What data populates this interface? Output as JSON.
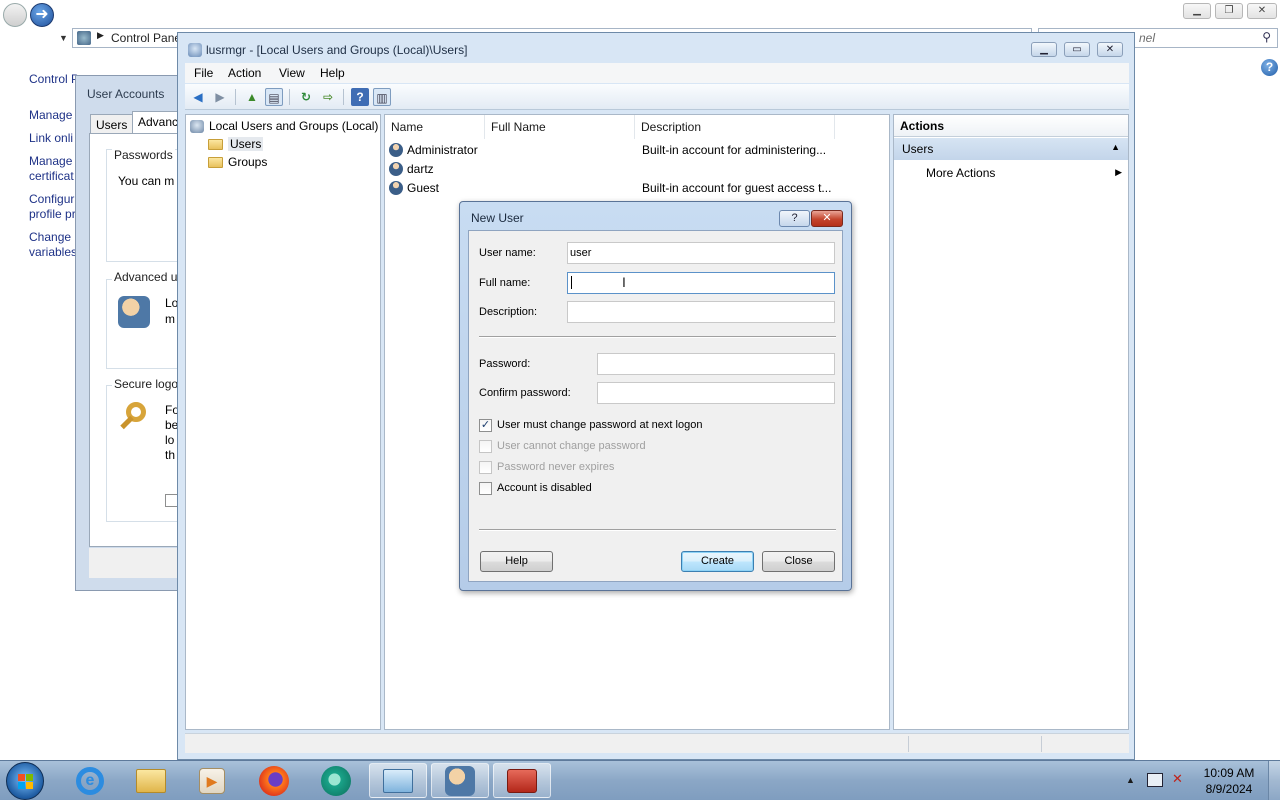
{
  "control_panel": {
    "address": "Control Panel",
    "search_placeholder": "nel",
    "heading": "Control P",
    "tasks": [
      "Manage",
      "Link onli",
      "Manage certificat",
      "Configur profile pr",
      "Change variables"
    ]
  },
  "user_accounts_dialog": {
    "title": "User Accounts",
    "tabs": [
      "Users",
      "Advanc"
    ],
    "passwords_group": "Passwords",
    "passwords_text": "You can m",
    "advanced_group": "Advanced u",
    "advanced_text_1": "Lo",
    "advanced_text_2": "m",
    "secure_group": "Secure logo",
    "secure_text": [
      "Fo",
      "be",
      "lo",
      "th"
    ]
  },
  "mmc": {
    "title": "lusrmgr - [Local Users and Groups (Local)\\Users]",
    "menu": [
      "File",
      "Action",
      "View",
      "Help"
    ],
    "tree": {
      "root": "Local Users and Groups (Local)",
      "children": [
        "Users",
        "Groups"
      ]
    },
    "columns": [
      "Name",
      "Full Name",
      "Description"
    ],
    "rows": [
      {
        "name": "Administrator",
        "full_name": "",
        "description": "Built-in account for administering..."
      },
      {
        "name": "dartz",
        "full_name": "",
        "description": ""
      },
      {
        "name": "Guest",
        "full_name": "",
        "description": "Built-in account for guest access t..."
      }
    ],
    "actions": {
      "header": "Actions",
      "section": "Users",
      "more_actions": "More Actions"
    }
  },
  "new_user": {
    "title": "New User",
    "help_glyph": "?",
    "close_glyph": "✕",
    "username_label": "User name:",
    "username_value": "user",
    "fullname_label": "Full name:",
    "fullname_value": "",
    "description_label": "Description:",
    "description_value": "",
    "password_label": "Password:",
    "confirm_label": "Confirm password:",
    "checkboxes": [
      {
        "label": "User must change password at next logon",
        "checked": true,
        "enabled": true
      },
      {
        "label": "User cannot change password",
        "checked": false,
        "enabled": false
      },
      {
        "label": "Password never expires",
        "checked": false,
        "enabled": false
      },
      {
        "label": "Account is disabled",
        "checked": false,
        "enabled": true
      }
    ],
    "buttons": {
      "help": "Help",
      "create": "Create",
      "close": "Close"
    }
  },
  "taskbar": {
    "apps": [
      "internet-explorer",
      "file-explorer",
      "media-player",
      "firefox",
      "chat-app",
      "remote-desktop",
      "user-accounts",
      "toolbox"
    ],
    "time": "10:09 AM",
    "date": "8/9/2024"
  }
}
